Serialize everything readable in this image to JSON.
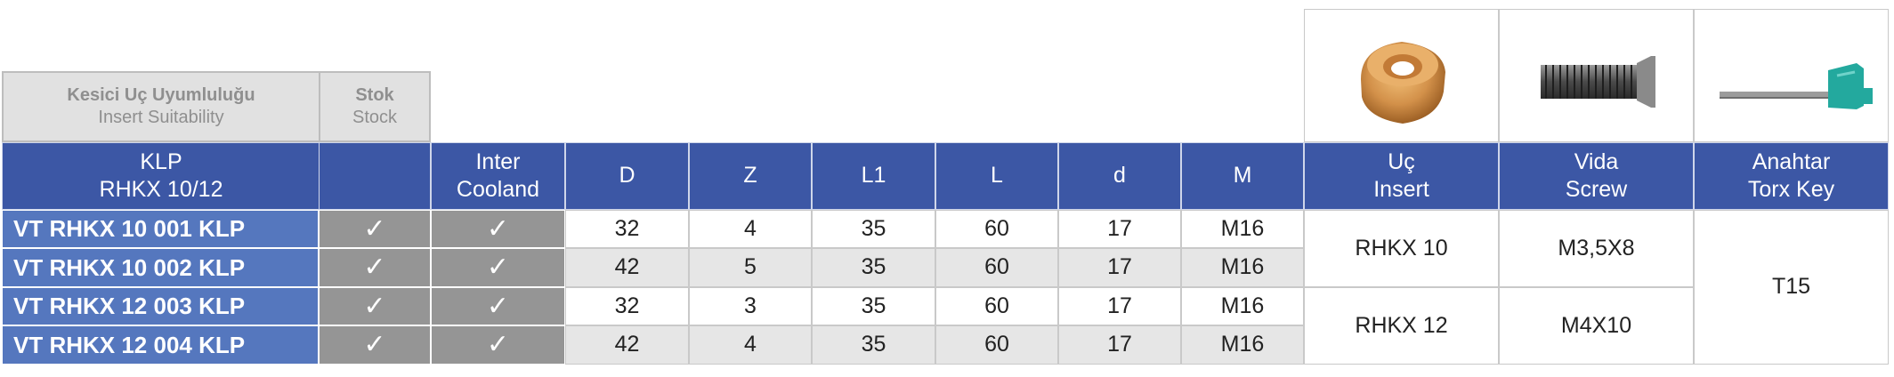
{
  "header_group": {
    "suitability_tr": "Kesici Uç Uyumluluğu",
    "suitability_en": "Insert Suitability",
    "stock_tr": "Stok",
    "stock_en": "Stock"
  },
  "columns": {
    "klp_line1": "KLP",
    "klp_line2": "RHKX 10/12",
    "stock": "",
    "inter_line1": "Inter",
    "inter_line2": "Cooland",
    "D": "D",
    "Z": "Z",
    "L1": "L1",
    "L": "L",
    "d": "d",
    "M": "M",
    "insert_tr": "Uç",
    "insert_en": "Insert",
    "screw_tr": "Vida",
    "screw_en": "Screw",
    "key_tr": "Anahtar",
    "key_en": "Torx Key"
  },
  "check_mark": "✓",
  "rows": [
    {
      "code": "VT RHKX 10 001 KLP",
      "D": "32",
      "Z": "4",
      "L1": "35",
      "L": "60",
      "d": "17",
      "M": "M16"
    },
    {
      "code": "VT RHKX 10 002 KLP",
      "D": "42",
      "Z": "5",
      "L1": "35",
      "L": "60",
      "d": "17",
      "M": "M16"
    },
    {
      "code": "VT RHKX 12 003 KLP",
      "D": "32",
      "Z": "3",
      "L1": "35",
      "L": "60",
      "d": "17",
      "M": "M16"
    },
    {
      "code": "VT RHKX 12 004 KLP",
      "D": "42",
      "Z": "4",
      "L1": "35",
      "L": "60",
      "d": "17",
      "M": "M16"
    }
  ],
  "accessories": {
    "insert_a": "RHKX 10",
    "screw_a": "M3,5X8",
    "insert_b": "RHKX 12",
    "screw_b": "M4X10",
    "key": "T15"
  },
  "images": {
    "insert": "round-insert-icon",
    "screw": "screw-icon",
    "key": "torx-key-icon"
  },
  "colors": {
    "header_blue": "#3c57a5",
    "code_blue": "#5577be",
    "check_gray": "#959595",
    "row_alt": "#e6e6e6"
  }
}
